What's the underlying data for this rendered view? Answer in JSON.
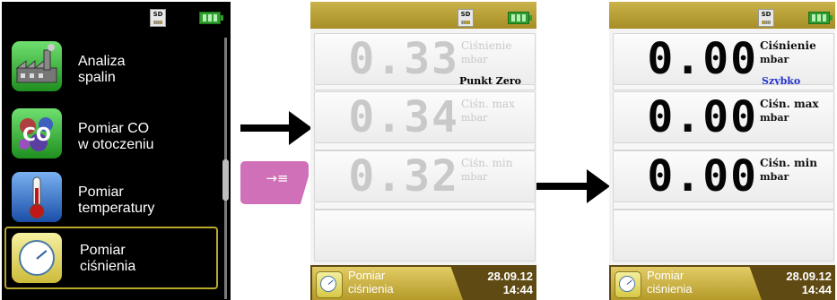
{
  "status": {
    "sd_label": "SD"
  },
  "menu": {
    "items": [
      {
        "label_line1": "Analiza",
        "label_line2": "spalin",
        "icon": "factory-icon"
      },
      {
        "label_line1": "Pomiar CO",
        "label_line2": "w otoczeniu",
        "icon": "co-molecule-icon"
      },
      {
        "label_line1": "Pomiar",
        "label_line2": "temperatury",
        "icon": "thermometer-icon"
      },
      {
        "label_line1": "Pomiar",
        "label_line2": "ciśnienia",
        "icon": "pressure-gauge-icon",
        "selected": true
      }
    ]
  },
  "key": {
    "glyph": "→≡",
    "color": "#d070b8"
  },
  "screen_before": {
    "mode_label": "Punkt Zero",
    "mode_color": "#9fa9ff",
    "readings": [
      {
        "value": "0.33",
        "label": "Ciśnienie",
        "unit": "mbar"
      },
      {
        "value": "0.34",
        "label": "Ciśn. max",
        "unit": "mbar"
      },
      {
        "value": "0.32",
        "label": "Ciśn. min",
        "unit": "mbar"
      }
    ],
    "footer": {
      "title_line1": "Pomiar",
      "title_line2": "ciśnienia",
      "date": "28.09.12",
      "time": "14:44"
    }
  },
  "screen_after": {
    "mode_label": "Szybko",
    "mode_color": "#2233cc",
    "readings": [
      {
        "value": "0.00",
        "label": "Ciśnienie",
        "unit": "mbar"
      },
      {
        "value": "0.00",
        "label": "Ciśn. max",
        "unit": "mbar"
      },
      {
        "value": "0.00",
        "label": "Ciśn. min",
        "unit": "mbar"
      }
    ],
    "footer": {
      "title_line1": "Pomiar",
      "title_line2": "ciśnienia",
      "date": "28.09.12",
      "time": "14:44"
    }
  },
  "colors": {
    "menu_bg": "#000000",
    "status_gold": "#b89f32",
    "footer_bg": "#5e4a12",
    "battery": "#2f9e2f"
  }
}
